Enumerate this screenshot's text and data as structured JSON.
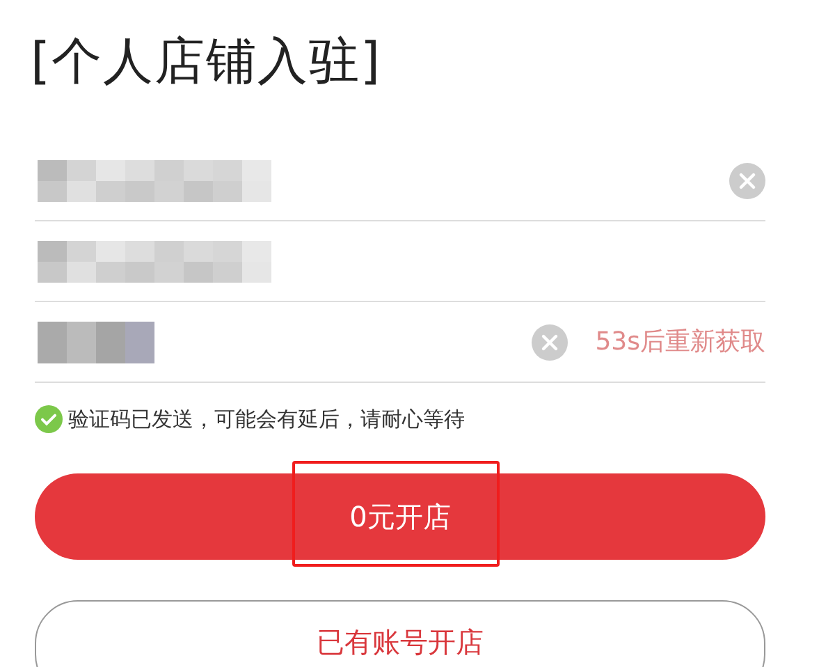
{
  "title": "[个人店铺入驻]",
  "fields": [
    {
      "redacted": true,
      "clear_button": true
    },
    {
      "redacted": true,
      "clear_button": false
    },
    {
      "redacted": true,
      "clear_button": true,
      "resend": "53s后重新获取"
    }
  ],
  "notice": {
    "text": "验证码已发送，可能会有延后，请耐心等待"
  },
  "buttons": [
    {
      "label": "0元开店",
      "kind": "primary",
      "highlighted": true
    },
    {
      "label": "已有账号开店",
      "kind": "outline",
      "highlighted": false
    }
  ]
}
